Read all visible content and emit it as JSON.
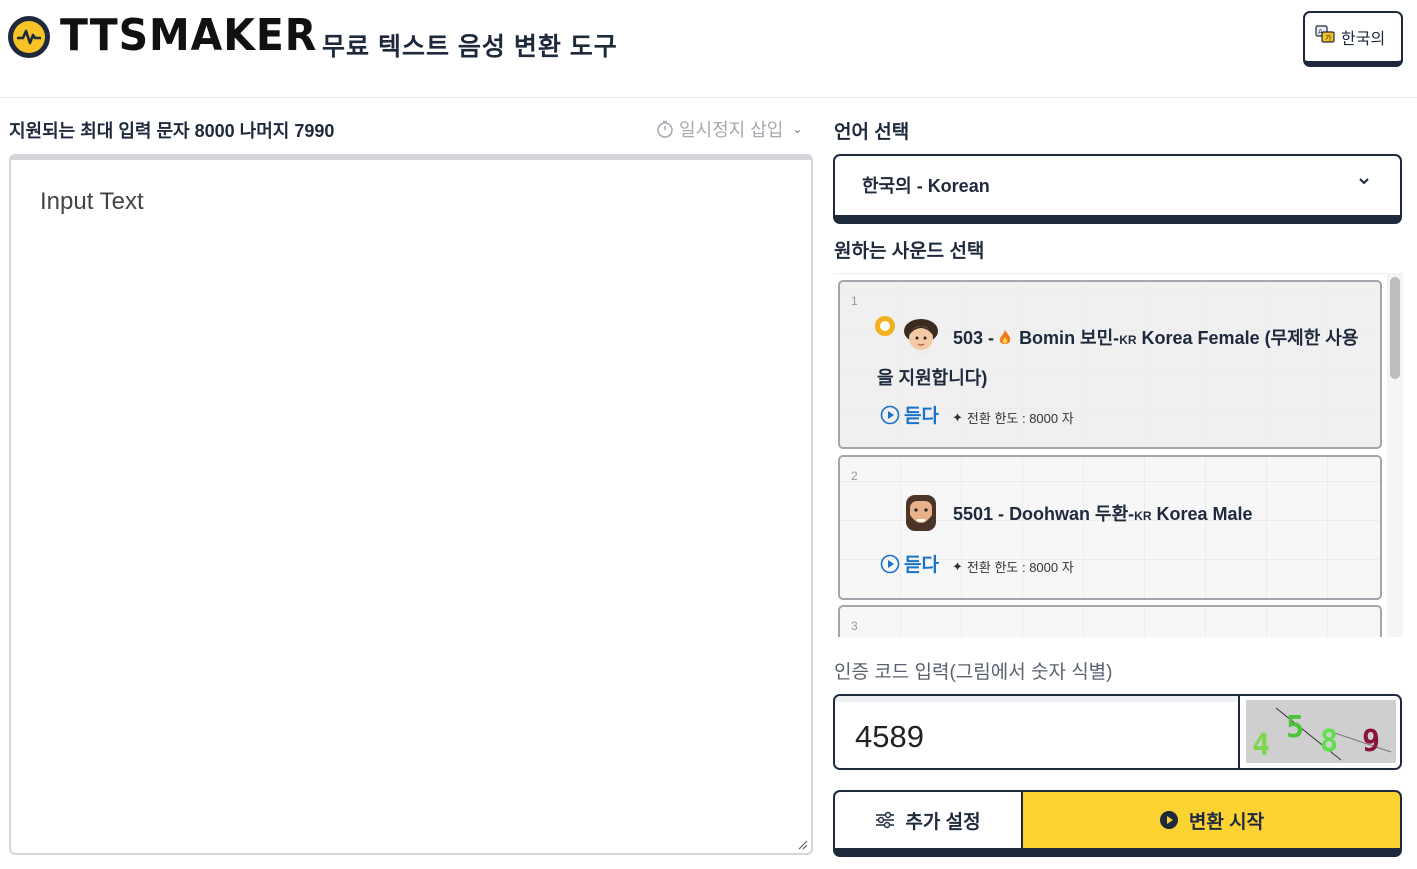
{
  "header": {
    "logo_text": "TTSMAKER",
    "tagline": "무료 텍스트 음성 변환 도구",
    "language_button": "한국의"
  },
  "input": {
    "char_info": "지원되는 최대 입력 문자 8000 나머지 7990",
    "pause_insert": "일시정지 삽입",
    "placeholder": "Input Text"
  },
  "language": {
    "label": "언어 선택",
    "selected_kr": "한국의",
    "selected_sep": " - ",
    "selected_en": "Korean"
  },
  "voices": {
    "label": "원하는 사운드 선택",
    "items": [
      {
        "num": "1",
        "id": "503 -",
        "name_a": "Bomin 보민-",
        "kr": "KR",
        "name_b": " Korea Female (무제한 사용",
        "name_c": "을 지원합니다)",
        "listen": "듣다",
        "limit": "전환 한도 : 8000 자",
        "selected": true
      },
      {
        "num": "2",
        "id": "5501 -",
        "name_a": "Doohwan 두환-",
        "kr": "KR",
        "name_b": " Korea Male",
        "listen": "듣다",
        "limit": "전환 한도 : 8000 자",
        "selected": false
      },
      {
        "num": "3"
      }
    ]
  },
  "captcha": {
    "label": "인증 코드 입력(그림에서 숫자 식별)",
    "value": "4589",
    "digits": [
      "4",
      "5",
      "8",
      "9"
    ]
  },
  "actions": {
    "settings": "추가 설정",
    "convert": "변환 시작"
  },
  "colors": {
    "navy": "#1e2a3c",
    "accent_yellow": "#fdd334",
    "link_blue": "#1a73c6",
    "radio_orange": "#f2b01e"
  }
}
